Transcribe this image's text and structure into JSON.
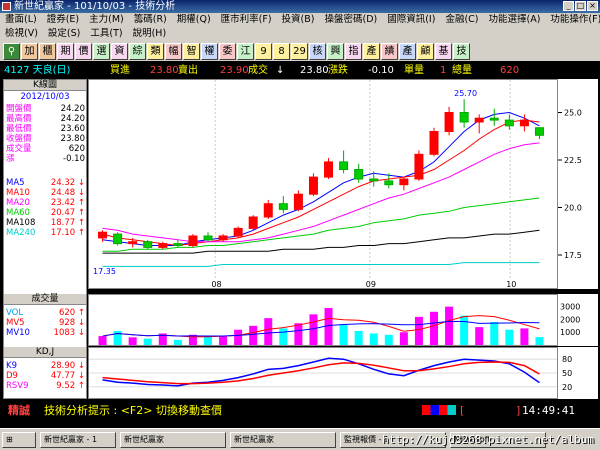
{
  "window": {
    "title": "新世紀贏家 - 101/10/03 - 技術分析"
  },
  "menu": {
    "row1": [
      "畫面(L)",
      "證券(E)",
      "主力(M)",
      "籌碼(R)",
      "期權(Q)",
      "匯市利率(F)",
      "投資(B)",
      "操盤密碼(D)",
      "國際資訊(I)",
      "金融(C)",
      "功能選擇(A)",
      "功能操作(F)"
    ],
    "row2": [
      "檢視(V)",
      "設定(S)",
      "工具(T)",
      "說明(H)"
    ]
  },
  "toolbar": {
    "buttons": [
      "加",
      "櫃",
      "期",
      "價",
      "選",
      "資",
      "綜",
      "類",
      "幅",
      "智",
      "權",
      "委",
      "江",
      "9",
      "8",
      "29",
      "核",
      "興",
      "指",
      "產",
      "績",
      "產",
      "顧",
      "基",
      "技"
    ]
  },
  "quote": {
    "stock": "4127 天良(日)",
    "bid_label": "買進",
    "bid": "23.80",
    "ask_label": "賣出",
    "ask": "23.90",
    "trade_label": "成交",
    "arrow": "↓",
    "trade": "23.80",
    "change_label": "漲跌",
    "change": "-0.10",
    "volume_label": "單量",
    "volume": "1",
    "total_label": "總量",
    "total": "620"
  },
  "left_panel": {
    "kline_title": "K線圖",
    "date": "2012/10/03",
    "ohlc": [
      {
        "label": "開盤價",
        "value": "24.20"
      },
      {
        "label": "最高價",
        "value": "24.20"
      },
      {
        "label": "最低價",
        "value": "23.60"
      },
      {
        "label": "收盤價",
        "value": "23.80"
      },
      {
        "label": "成交量",
        "value": "620"
      },
      {
        "label": "漲",
        "value": "-0.10"
      }
    ],
    "ma": [
      {
        "label": "MA5",
        "value": "24.32",
        "arrow": "↓",
        "color": "#0000ff"
      },
      {
        "label": "MA10",
        "value": "24.48",
        "arrow": "↓",
        "color": "#ff0000"
      },
      {
        "label": "MA20",
        "value": "23.42",
        "arrow": "↑",
        "color": "#ff00ff"
      },
      {
        "label": "MA60",
        "value": "20.47",
        "arrow": "↑",
        "color": "#00cc00"
      },
      {
        "label": "MA108",
        "value": "18.77",
        "arrow": "↑",
        "color": "#000000"
      },
      {
        "label": "MA240",
        "value": "17.10",
        "arrow": "↑",
        "color": "#00cccc"
      }
    ],
    "vol_title": "成交量",
    "vol": [
      {
        "label": "VOL",
        "value": "620",
        "arrow": "↑",
        "color": "#00a0ff"
      },
      {
        "label": "MV5",
        "value": "928",
        "arrow": "↓",
        "color": "#ff0000"
      },
      {
        "label": "MV10",
        "value": "1083",
        "arrow": "↓",
        "color": "#0000ff"
      }
    ],
    "kd_title": "KD,J",
    "kd": [
      {
        "label": "K9",
        "value": "28.90",
        "arrow": "↓",
        "color": "#0000ff"
      },
      {
        "label": "D9",
        "value": "47.77",
        "arrow": "↓",
        "color": "#ff0000"
      },
      {
        "label": "RSV9",
        "value": "9.52",
        "arrow": "↑",
        "color": "#ff00ff"
      }
    ]
  },
  "chart_data": [
    {
      "type": "line",
      "title": "K線圖",
      "x_ticks": [
        "08",
        "09",
        "10"
      ],
      "y_ticks": [
        "25.0",
        "22.5",
        "20.0",
        "17.5"
      ],
      "ylim": [
        16.5,
        26.5
      ],
      "annotations": {
        "high": "25.70",
        "low": "17.35"
      },
      "series": [
        {
          "name": "MA5",
          "color": "#0000ff",
          "values": [
            18.3,
            18.2,
            18.1,
            18.0,
            18.0,
            18.0,
            18.2,
            18.3,
            18.4,
            18.5,
            18.8,
            19.2,
            19.6,
            19.9,
            20.3,
            20.8,
            21.3,
            21.6,
            21.8,
            21.7,
            21.6,
            21.9,
            22.4,
            23.2,
            24.0,
            24.6,
            24.9,
            25.0,
            24.7,
            24.3
          ]
        },
        {
          "name": "MA10",
          "color": "#ff0000",
          "values": [
            18.6,
            18.4,
            18.3,
            18.2,
            18.1,
            18.0,
            18.1,
            18.2,
            18.3,
            18.4,
            18.6,
            18.9,
            19.2,
            19.5,
            19.9,
            20.3,
            20.7,
            21.1,
            21.4,
            21.5,
            21.6,
            21.7,
            22.0,
            22.5,
            23.0,
            23.6,
            24.1,
            24.5,
            24.6,
            24.5
          ]
        },
        {
          "name": "MA20",
          "color": "#ff00ff",
          "values": [
            18.9,
            18.8,
            18.6,
            18.5,
            18.4,
            18.3,
            18.2,
            18.2,
            18.2,
            18.2,
            18.3,
            18.4,
            18.6,
            18.8,
            19.0,
            19.3,
            19.6,
            19.9,
            20.2,
            20.5,
            20.7,
            21.0,
            21.3,
            21.6,
            22.0,
            22.4,
            22.8,
            23.1,
            23.3,
            23.4
          ]
        },
        {
          "name": "MA60",
          "color": "#00cc00",
          "values": [
            17.7,
            17.7,
            17.8,
            17.8,
            17.8,
            17.9,
            17.9,
            18.0,
            18.0,
            18.1,
            18.2,
            18.3,
            18.4,
            18.5,
            18.6,
            18.8,
            18.9,
            19.0,
            19.2,
            19.3,
            19.4,
            19.6,
            19.7,
            19.8,
            20.0,
            20.1,
            20.2,
            20.3,
            20.4,
            20.5
          ]
        },
        {
          "name": "MA108",
          "color": "#000000",
          "values": [
            17.6,
            17.6,
            17.6,
            17.6,
            17.6,
            17.6,
            17.6,
            17.7,
            17.7,
            17.7,
            17.7,
            17.7,
            17.8,
            17.8,
            17.8,
            17.9,
            17.9,
            18.0,
            18.0,
            18.1,
            18.1,
            18.2,
            18.3,
            18.4,
            18.4,
            18.5,
            18.6,
            18.6,
            18.7,
            18.8
          ]
        },
        {
          "name": "MA240",
          "color": "#00cccc",
          "values": [
            16.9,
            16.9,
            16.9,
            16.9,
            16.9,
            16.9,
            16.9,
            16.9,
            17.0,
            17.0,
            17.0,
            17.0,
            17.0,
            17.0,
            17.0,
            17.0,
            17.0,
            17.0,
            17.0,
            17.0,
            17.0,
            17.0,
            17.0,
            17.0,
            17.1,
            17.1,
            17.1,
            17.1,
            17.1,
            17.1
          ]
        }
      ],
      "candles": [
        [
          18.4,
          18.8,
          18.2,
          18.7
        ],
        [
          18.6,
          18.7,
          18.0,
          18.1
        ],
        [
          18.1,
          18.4,
          17.9,
          18.2
        ],
        [
          18.2,
          18.3,
          17.8,
          17.9
        ],
        [
          17.9,
          18.2,
          17.8,
          18.1
        ],
        [
          18.1,
          18.3,
          17.9,
          18.0
        ],
        [
          18.0,
          18.6,
          17.9,
          18.5
        ],
        [
          18.5,
          18.7,
          18.2,
          18.3
        ],
        [
          18.3,
          18.6,
          18.2,
          18.5
        ],
        [
          18.5,
          19.0,
          18.4,
          18.9
        ],
        [
          18.9,
          19.6,
          18.8,
          19.5
        ],
        [
          19.5,
          20.4,
          19.4,
          20.2
        ],
        [
          20.2,
          20.6,
          19.7,
          19.9
        ],
        [
          19.9,
          20.9,
          19.8,
          20.7
        ],
        [
          20.7,
          21.8,
          20.6,
          21.6
        ],
        [
          21.6,
          22.6,
          21.5,
          22.4
        ],
        [
          22.4,
          23.0,
          21.8,
          22.0
        ],
        [
          22.0,
          22.3,
          21.3,
          21.5
        ],
        [
          21.5,
          21.9,
          21.1,
          21.4
        ],
        [
          21.4,
          21.8,
          21.0,
          21.2
        ],
        [
          21.2,
          21.6,
          20.9,
          21.5
        ],
        [
          21.5,
          23.0,
          21.4,
          22.8
        ],
        [
          22.8,
          24.2,
          22.7,
          24.0
        ],
        [
          24.0,
          25.3,
          23.8,
          25.0
        ],
        [
          25.0,
          25.7,
          24.2,
          24.5
        ],
        [
          24.5,
          24.9,
          23.9,
          24.7
        ],
        [
          24.7,
          25.2,
          24.3,
          24.6
        ],
        [
          24.6,
          24.9,
          24.1,
          24.3
        ],
        [
          24.3,
          24.9,
          24.0,
          24.6
        ],
        [
          24.2,
          24.2,
          23.6,
          23.8
        ]
      ]
    },
    {
      "type": "bar",
      "title": "成交量",
      "y_ticks": [
        "3000",
        "2000",
        "1000"
      ],
      "ylim": [
        0,
        3600
      ],
      "values": [
        700,
        1100,
        600,
        500,
        900,
        400,
        800,
        650,
        700,
        1200,
        1500,
        2100,
        1300,
        1700,
        2400,
        2900,
        1600,
        1100,
        900,
        800,
        1000,
        2200,
        2600,
        3000,
        2300,
        1400,
        1800,
        1200,
        1300,
        620
      ]
    },
    {
      "type": "line",
      "title": "KD,J",
      "y_ticks": [
        "80",
        "50",
        "20"
      ],
      "ylim": [
        0,
        100
      ],
      "series": [
        {
          "name": "K9",
          "color": "#0000ff",
          "values": [
            35,
            30,
            28,
            25,
            24,
            22,
            28,
            30,
            34,
            40,
            48,
            58,
            60,
            66,
            74,
            82,
            80,
            70,
            58,
            48,
            44,
            56,
            66,
            74,
            80,
            78,
            76,
            70,
            52,
            29
          ]
        },
        {
          "name": "D9",
          "color": "#ff0000",
          "values": [
            40,
            37,
            34,
            31,
            29,
            27,
            27,
            28,
            30,
            33,
            38,
            45,
            50,
            55,
            61,
            68,
            72,
            71,
            67,
            61,
            55,
            55,
            59,
            64,
            70,
            73,
            74,
            73,
            66,
            48
          ]
        }
      ]
    }
  ],
  "status": {
    "left": "精誠",
    "hint": "技術分析提示 : <F2> 切換移動查價",
    "bracket_open": "[",
    "bracket_close": "]",
    "time": "14:49:41"
  },
  "taskbar": {
    "items": [
      "新世紀贏家 - 1",
      "新世紀贏家",
      "新世紀贏家",
      "監視報價 - 1",
      "Microsoft"
    ]
  },
  "watermark": "http://kujd3268.pixnet.net/album"
}
